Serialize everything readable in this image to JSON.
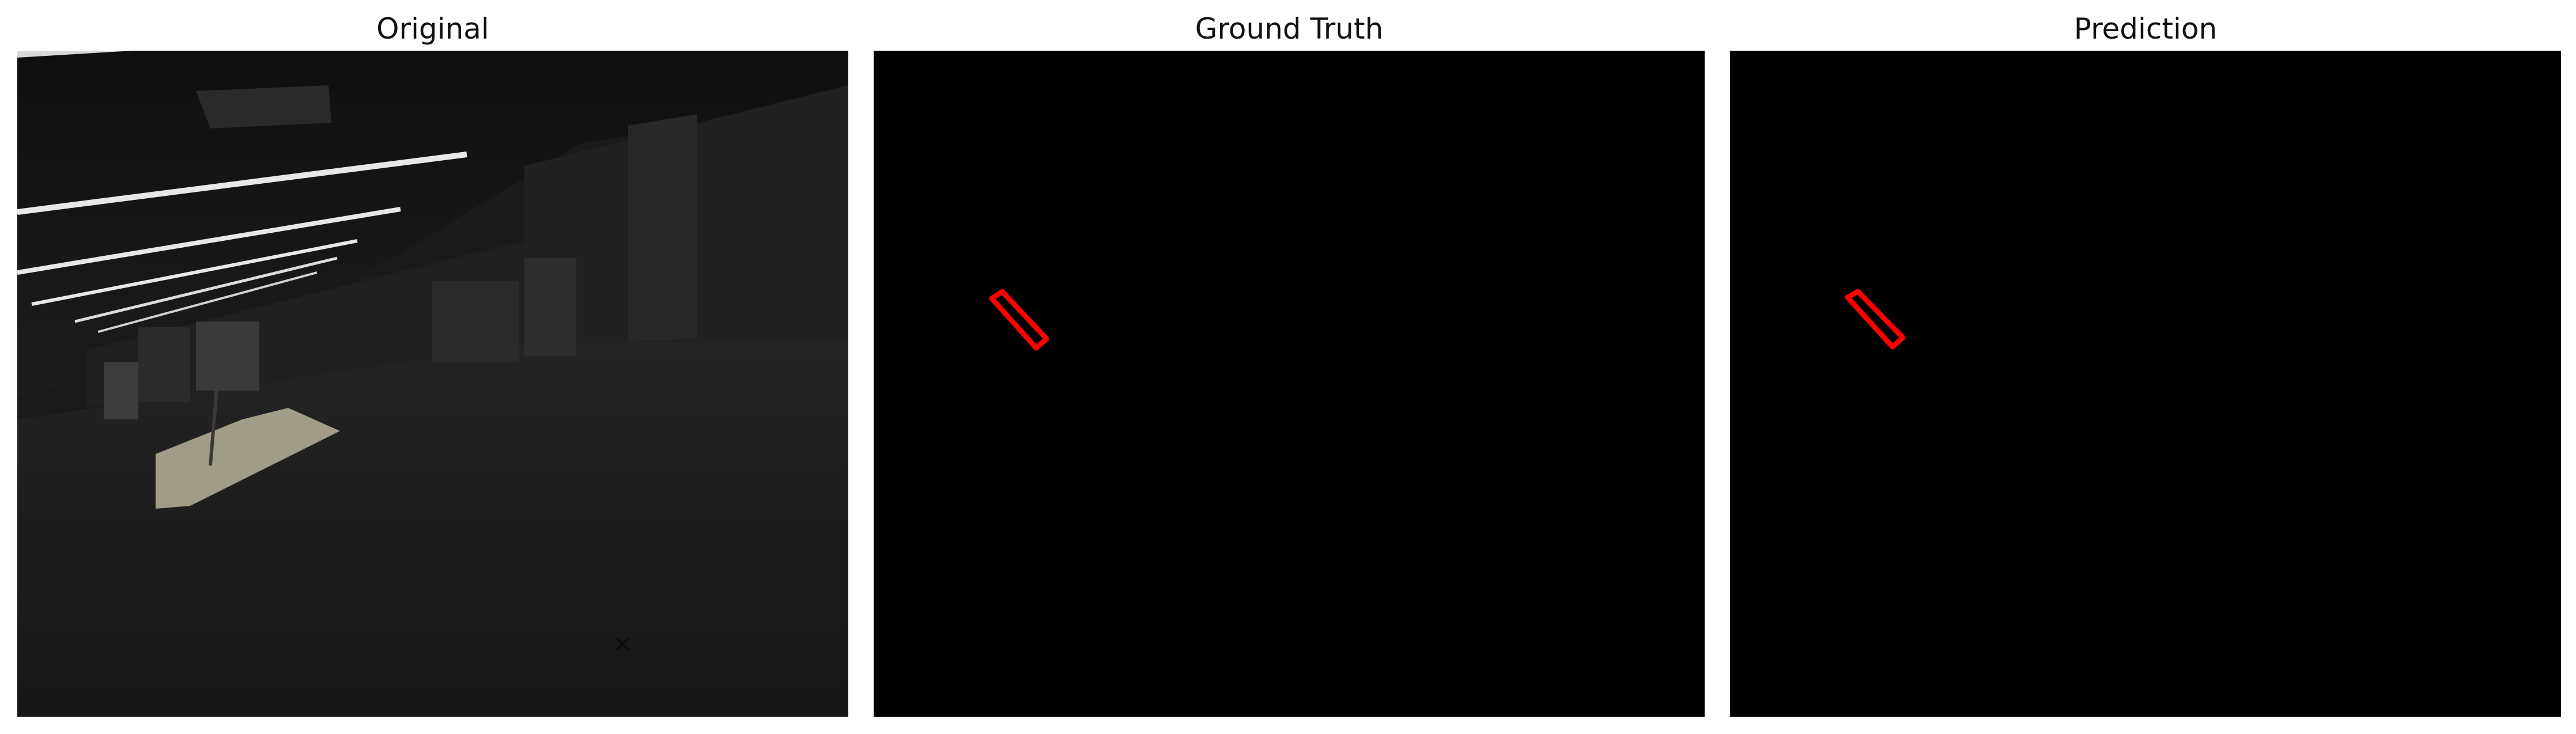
{
  "figure": {
    "panels": [
      {
        "title": "Original"
      },
      {
        "title": "Ground Truth"
      },
      {
        "title": "Prediction"
      }
    ]
  },
  "colors": {
    "background": "#ffffff",
    "mask_background": "#000000",
    "mask_outline": "#ff0000",
    "scene_dark": "#1b1b1c",
    "ceiling_light": "#e8e8e8",
    "floor_mat": "#b9b39a"
  }
}
